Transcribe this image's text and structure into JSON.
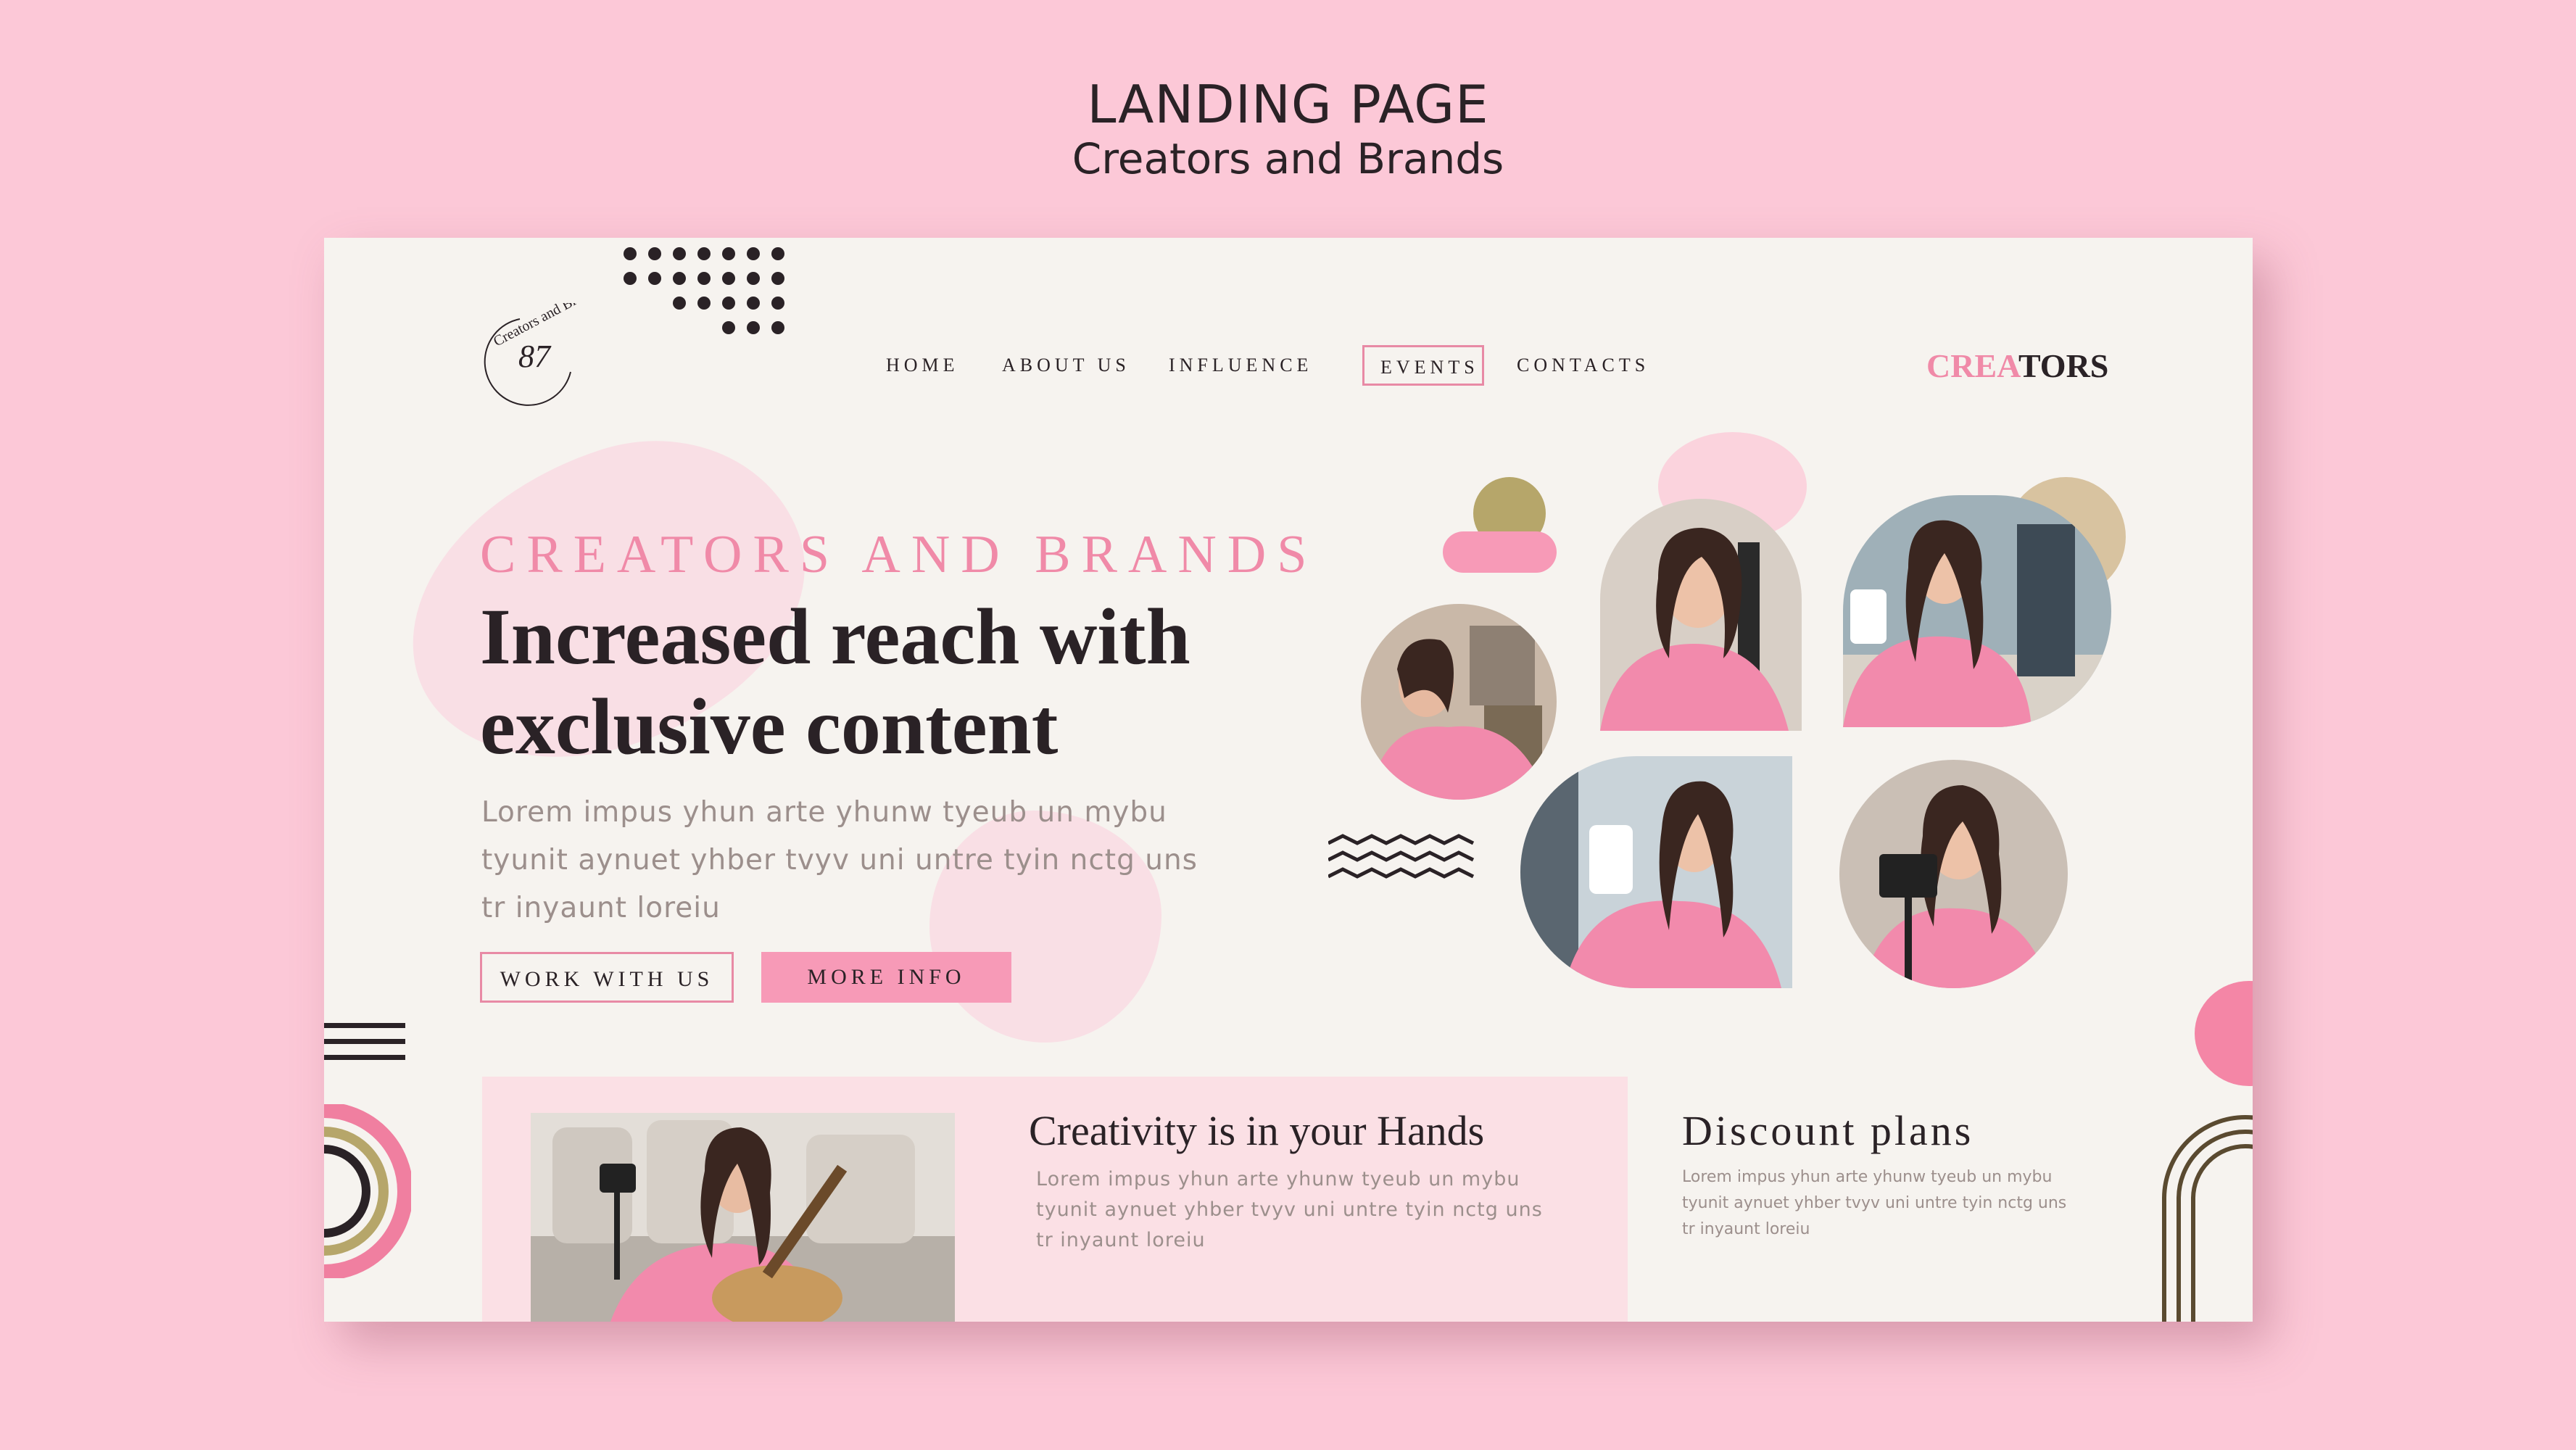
{
  "presentation": {
    "title": "LANDING PAGE",
    "subtitle": "Creators and Brands"
  },
  "logo": {
    "number": "87",
    "ring_text": "Creators and Brands"
  },
  "nav": {
    "items": [
      {
        "label": "HOME"
      },
      {
        "label": "ABOUT US"
      },
      {
        "label": "INFLUENCE"
      },
      {
        "label": "EVENTS",
        "active": true
      },
      {
        "label": "CONTACTS"
      }
    ]
  },
  "brand": {
    "part1": "CREA",
    "part2": "TORS"
  },
  "hero": {
    "eyebrow": "CREATORS AND BRANDS",
    "headline_line1": "Increased reach with",
    "headline_line2": "exclusive content",
    "body_line1": "Lorem impus yhun arte yhunw tyeub un mybu",
    "body_line2": "tyunit aynuet yhber tvyv uni untre tyin nctg uns",
    "body_line3": "tr inyaunt loreiu",
    "primary_button": "WORK WITH US",
    "secondary_button": "MORE INFO"
  },
  "feature": {
    "title": "Creativity is in your Hands",
    "body_line1": "Lorem impus yhun arte yhunw tyeub un mybu",
    "body_line2": "tyunit aynuet yhber tvyv uni untre tyin nctg uns",
    "body_line3": "tr inyaunt loreiu"
  },
  "discount": {
    "title": "Discount plans",
    "body_line1": "Lorem impus yhun arte yhunw tyeub un mybu",
    "body_line2": "tyunit aynuet yhber tvyv uni untre tyin nctg uns",
    "body_line3": "tr inyaunt loreiu"
  },
  "colors": {
    "page_bg": "#fcc8d7",
    "card_bg": "#f6f3ef",
    "accent_pink": "#f08aa8",
    "blush": "#f9dfe5",
    "text_dark": "#2a2226",
    "gold": "#b6a66a",
    "tan": "#d8c3a0",
    "brown": "#5a4a30"
  }
}
